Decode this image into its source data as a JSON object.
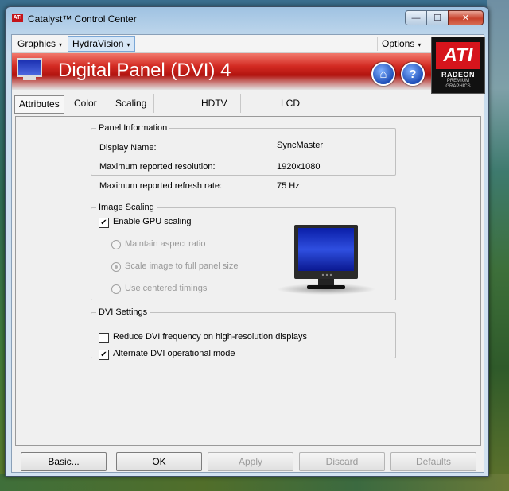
{
  "window": {
    "title": "Catalyst™ Control Center",
    "icon_text": "ATI",
    "min_glyph": "—",
    "max_glyph": "☐",
    "close_glyph": "✕"
  },
  "menubar": {
    "graphics": "Graphics",
    "hydravision": "HydraVision",
    "options": "Options",
    "arrow": "▾"
  },
  "logo": {
    "ati": "ATI",
    "radeon": "RADEON",
    "premium": "PREMIUM",
    "graphics": "GRAPHICS"
  },
  "header": {
    "title": "Digital Panel (DVI) 4",
    "home_glyph": "⌂",
    "help_glyph": "?"
  },
  "tabs": [
    "Attributes",
    "Color",
    "Scaling Options",
    "HDTV Support",
    "LCD Overdrive"
  ],
  "panel_info": {
    "legend": "Panel Information",
    "rows": [
      {
        "label": "Display Name:",
        "value": "SyncMaster"
      },
      {
        "label": "Maximum reported resolution:",
        "value": "1920x1080"
      },
      {
        "label": "Maximum reported refresh rate:",
        "value": "75 Hz"
      }
    ]
  },
  "image_scaling": {
    "legend": "Image Scaling",
    "enable_gpu_scaling": {
      "label": "Enable GPU scaling",
      "checked": true,
      "mark": "✔"
    },
    "options": [
      {
        "label": "Maintain aspect ratio",
        "selected": false
      },
      {
        "label": "Scale image to full panel size",
        "selected": true
      },
      {
        "label": "Use centered timings",
        "selected": false
      }
    ]
  },
  "dvi_settings": {
    "legend": "DVI Settings",
    "reduce_freq": {
      "label": "Reduce DVI frequency on high-resolution displays",
      "checked": false
    },
    "alternate_mode": {
      "label": "Alternate DVI operational mode",
      "checked": true,
      "mark": "✔"
    }
  },
  "buttons": {
    "basic": "Basic...",
    "ok": "OK",
    "apply": "Apply",
    "discard": "Discard",
    "defaults": "Defaults"
  },
  "colors": {
    "accent_red": "#d32b23",
    "screen_blue": "#1b2fb0"
  }
}
